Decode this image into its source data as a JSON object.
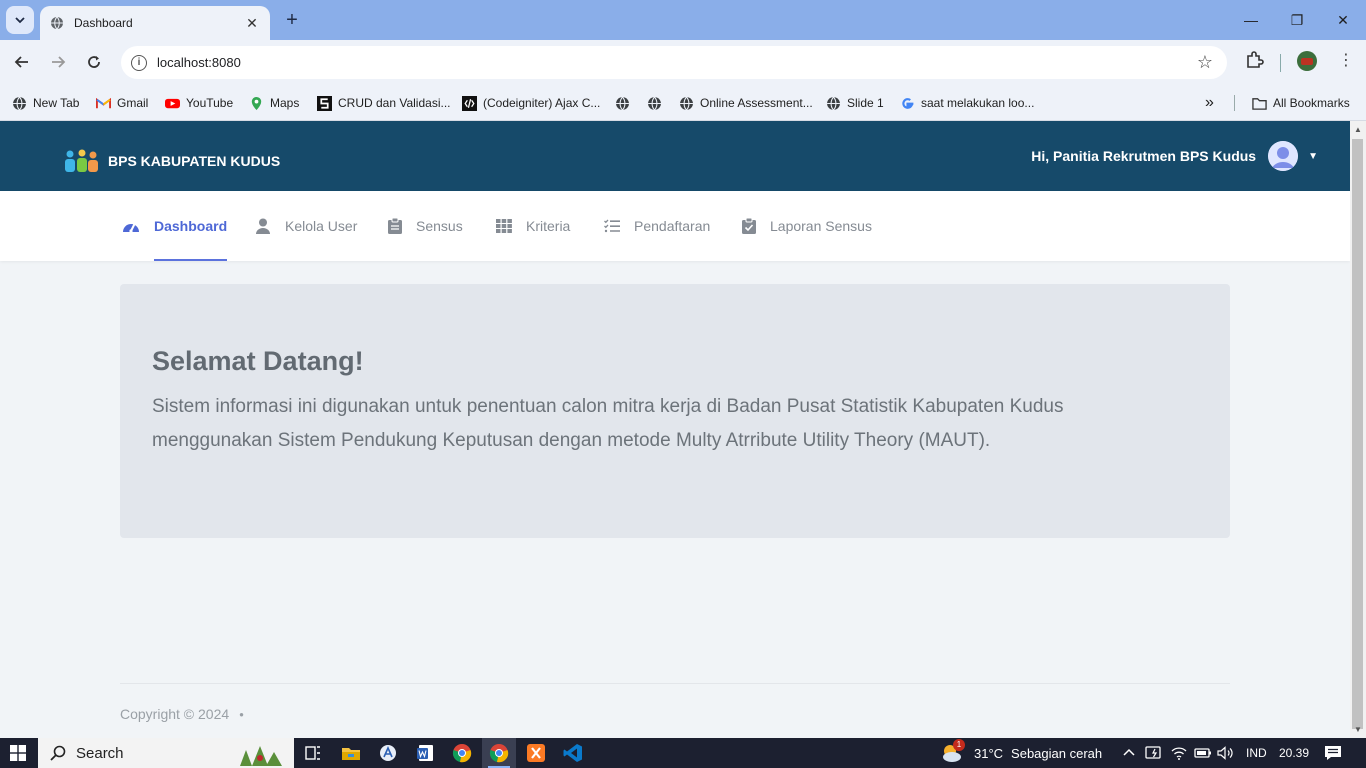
{
  "browser": {
    "tab_title": "Dashboard",
    "new_tab_symbol": "+",
    "url": "localhost:8080",
    "bookmarks": [
      {
        "label": "New Tab",
        "icon": "globe-icon"
      },
      {
        "label": "Gmail",
        "icon": "gmail-icon"
      },
      {
        "label": "YouTube",
        "icon": "youtube-icon"
      },
      {
        "label": "Maps",
        "icon": "maps-icon"
      },
      {
        "label": "CRUD dan Validasi...",
        "icon": "site-icon"
      },
      {
        "label": "(Codeigniter) Ajax C...",
        "icon": "code-icon"
      },
      {
        "label": "",
        "icon": "globe-icon"
      },
      {
        "label": "",
        "icon": "globe-icon"
      },
      {
        "label": "Online Assessment...",
        "icon": "globe-icon"
      },
      {
        "label": "Slide 1",
        "icon": "globe-icon"
      },
      {
        "label": "saat melakukan loo...",
        "icon": "google-icon"
      }
    ],
    "more_bookmarks": "»",
    "all_bookmarks": "All Bookmarks"
  },
  "header": {
    "brand": "BPS KABUPATEN KUDUS",
    "greeting": "Hi, Panitia Rekrutmen BPS Kudus"
  },
  "menu": [
    {
      "label": "Dashboard",
      "icon": "dashboard-gauge-icon",
      "active": true
    },
    {
      "label": "Kelola User",
      "icon": "user-icon",
      "active": false
    },
    {
      "label": "Sensus",
      "icon": "clipboard-icon",
      "active": false
    },
    {
      "label": "Kriteria",
      "icon": "grid-icon",
      "active": false
    },
    {
      "label": "Pendaftaran",
      "icon": "checklist-icon",
      "active": false
    },
    {
      "label": "Laporan Sensus",
      "icon": "clipboard-check-icon",
      "active": false
    }
  ],
  "welcome": {
    "title": "Selamat Datang!",
    "text": "Sistem informasi ini digunakan untuk penentuan calon mitra kerja di Badan Pusat Statistik Kabupaten Kudus menggunakan Sistem Pendukung Keputusan dengan metode Multy Atrribute Utility Theory (MAUT)."
  },
  "footer": {
    "copyright": "Copyright © 2024"
  },
  "taskbar": {
    "search_label": "Search",
    "weather_badge": "1",
    "weather_temp": "31°C",
    "weather_desc": "Sebagian cerah",
    "language": "IND",
    "time": "20.39"
  },
  "colors": {
    "header_bg": "#164a6a",
    "accent": "#4e68d6",
    "page_bg": "#f1f4f7",
    "jumbotron_bg": "#e2e6ec"
  }
}
